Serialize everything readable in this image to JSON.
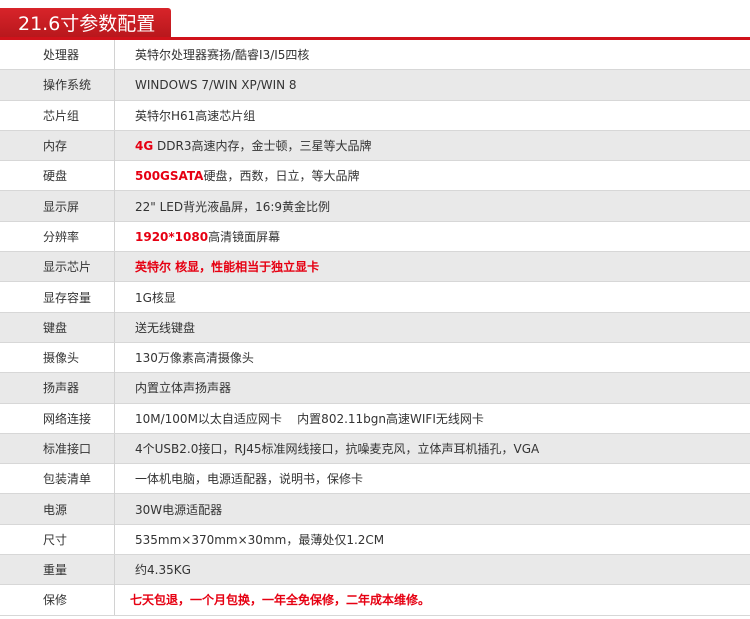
{
  "title": "21.6寸参数配置",
  "rows": [
    {
      "label": "处理器",
      "value": "英特尔处理器赛扬/酷睿I3/I5四核"
    },
    {
      "label": "操作系统",
      "value": "WINDOWS 7/WIN XP/WIN 8"
    },
    {
      "label": "芯片组",
      "value": "英特尔H61高速芯片组"
    },
    {
      "label": "内存",
      "highlight": "4G",
      "value": " DDR3高速内存，金士顿，三星等大品牌"
    },
    {
      "label": "硬盘",
      "highlight": "500GSATA",
      "value": "硬盘，西数，日立，等大品牌"
    },
    {
      "label": "显示屏",
      "value": "22\" LED背光液晶屏，16:9黄金比例"
    },
    {
      "label": "分辨率",
      "highlight": "1920*1080",
      "value": "高清镜面屏幕"
    },
    {
      "label": "显示芯片",
      "highlight": "英特尔 核显，性能相当于独立显卡"
    },
    {
      "label": "显存容量",
      "value": "1G核显"
    },
    {
      "label": "键盘",
      "value": "送无线键盘"
    },
    {
      "label": "摄像头",
      "value": "130万像素高清摄像头"
    },
    {
      "label": "扬声器",
      "value": "内置立体声扬声器"
    },
    {
      "label": "网络连接",
      "value": "10M/100M以太自适应网卡    内置802.11bgn高速WIFI无线网卡"
    },
    {
      "label": "标准接口",
      "value": "4个USB2.0接口，RJ45标准网线接口，抗噪麦克风，立体声耳机插孔，VGA"
    },
    {
      "label": "包装清单",
      "value": "一体机电脑，电源适配器，说明书，保修卡"
    },
    {
      "label": "电源",
      "value": "30W电源适配器"
    },
    {
      "label": "尺寸",
      "value": "535mm×370mm×30mm，最薄处仅1.2CM"
    },
    {
      "label": "重量",
      "value": "约4.35KG"
    },
    {
      "label": "保修",
      "highlight": "七天包退，一个月包换，一年全免保修，二年成本维修。"
    }
  ]
}
